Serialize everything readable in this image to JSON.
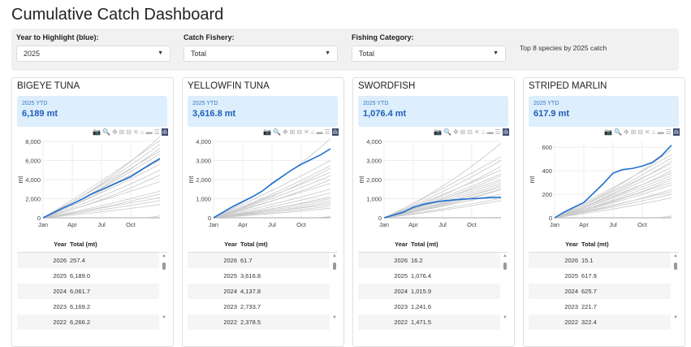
{
  "title": "Cumulative Catch Dashboard",
  "filters": [
    {
      "label": "Year to Highlight (blue):",
      "value": "2025"
    },
    {
      "label": "Catch Fishery:",
      "value": "Total"
    },
    {
      "label": "Fishing Category:",
      "value": "Total"
    }
  ],
  "note": "Top 8 species by 2025 catch",
  "colors": {
    "highlight": "#1f6fd1",
    "other": "#c8c8c8",
    "kpi_bg": "#ddeefc"
  },
  "table_headers": {
    "year": "Year",
    "total": "Total (mt)"
  },
  "toolbar_icons": [
    "camera-icon",
    "zoom-icon",
    "pan-icon",
    "zoom-in-icon",
    "zoom-out-icon",
    "autoscale-icon",
    "home-icon",
    "spike-lines-icon",
    "compare-hover-icon",
    "plotly-logo-icon"
  ],
  "chart_data": [
    {
      "type": "line",
      "title": "BIGEYE TUNA",
      "kpi_label": "2025 YTD",
      "kpi_value": "6,189 mt",
      "ylabel": "mt",
      "ylim": [
        0,
        8000
      ],
      "yticks": [
        "0",
        "2,000",
        "4,000",
        "6,000",
        "8,000"
      ],
      "ytick_values": [
        0,
        2000,
        4000,
        6000,
        8000
      ],
      "xticks": [
        "Jan",
        "Apr",
        "Jul",
        "Oct"
      ],
      "highlight": [
        0,
        500,
        1000,
        1450,
        1950,
        2500,
        2950,
        3400,
        3850,
        4300,
        4950,
        5600,
        6189
      ],
      "other_year_totals": [
        8500,
        8100,
        7700,
        7300,
        7000,
        6700,
        6300,
        6000,
        5600,
        5000,
        4500,
        3800,
        2800,
        2500,
        2100,
        1800,
        1400,
        200
      ],
      "rows": [
        [
          "2026",
          "257.4"
        ],
        [
          "2025",
          "6,189.0"
        ],
        [
          "2024",
          "6,061.7"
        ],
        [
          "2023",
          "6,169.2"
        ],
        [
          "2022",
          "6,266.2"
        ]
      ]
    },
    {
      "type": "line",
      "title": "YELLOWFIN TUNA",
      "kpi_label": "2025 YTD",
      "kpi_value": "3,616.8 mt",
      "ylabel": "mt",
      "ylim": [
        0,
        4000
      ],
      "yticks": [
        "0",
        "1,000",
        "2,000",
        "3,000",
        "4,000"
      ],
      "ytick_values": [
        0,
        1000,
        2000,
        3000,
        4000
      ],
      "xticks": [
        "Jan",
        "Apr",
        "Jul",
        "Oct"
      ],
      "highlight": [
        0,
        300,
        600,
        850,
        1100,
        1400,
        1800,
        2150,
        2500,
        2800,
        3050,
        3300,
        3617
      ],
      "other_year_totals": [
        4138,
        3000,
        2734,
        2600,
        2379,
        2200,
        2000,
        1800,
        1500,
        1300,
        1100,
        1000,
        900,
        800,
        700,
        600,
        500,
        62
      ],
      "rows": [
        [
          "2026",
          "61.7"
        ],
        [
          "2025",
          "3,616.8"
        ],
        [
          "2024",
          "4,137.8"
        ],
        [
          "2023",
          "2,733.7"
        ],
        [
          "2022",
          "2,378.5"
        ]
      ]
    },
    {
      "type": "line",
      "title": "SWORDFISH",
      "kpi_label": "2025 YTD",
      "kpi_value": "1,076.4 mt",
      "ylabel": "mt",
      "ylim": [
        0,
        4000
      ],
      "yticks": [
        "0",
        "1,000",
        "2,000",
        "3,000",
        "4,000"
      ],
      "ytick_values": [
        0,
        1000,
        2000,
        3000,
        4000
      ],
      "xticks": [
        "Jan",
        "Apr",
        "Jul",
        "Oct"
      ],
      "highlight": [
        0,
        150,
        300,
        550,
        700,
        800,
        880,
        930,
        970,
        1000,
        1030,
        1060,
        1076
      ],
      "other_year_totals": [
        3900,
        3200,
        3000,
        2700,
        2500,
        2300,
        2200,
        2000,
        1900,
        1800,
        1700,
        1600,
        1500,
        1472,
        1242,
        1016,
        900,
        16
      ],
      "rows": [
        [
          "2026",
          "16.2"
        ],
        [
          "2025",
          "1,076.4"
        ],
        [
          "2024",
          "1,015.9"
        ],
        [
          "2023",
          "1,241.6"
        ],
        [
          "2022",
          "1,471.5"
        ]
      ]
    },
    {
      "type": "line",
      "title": "STRIPED MARLIN",
      "kpi_label": "2025 YTD",
      "kpi_value": "617.9 mt",
      "ylabel": "mt",
      "ylim": [
        0,
        650
      ],
      "yticks": [
        "0",
        "200",
        "400",
        "600"
      ],
      "ytick_values": [
        0,
        200,
        400,
        600
      ],
      "xticks": [
        "Jan",
        "Apr",
        "Jul",
        "Oct"
      ],
      "highlight": [
        0,
        50,
        90,
        130,
        210,
        290,
        380,
        410,
        420,
        440,
        470,
        530,
        618
      ],
      "other_year_totals": [
        580,
        540,
        510,
        480,
        460,
        430,
        400,
        380,
        360,
        340,
        322,
        300,
        280,
        240,
        222,
        200,
        170,
        15
      ],
      "rows": [
        [
          "2026",
          "15.1"
        ],
        [
          "2025",
          "617.9"
        ],
        [
          "2024",
          "625.7"
        ],
        [
          "2023",
          "221.7"
        ],
        [
          "2022",
          "322.4"
        ]
      ]
    }
  ]
}
